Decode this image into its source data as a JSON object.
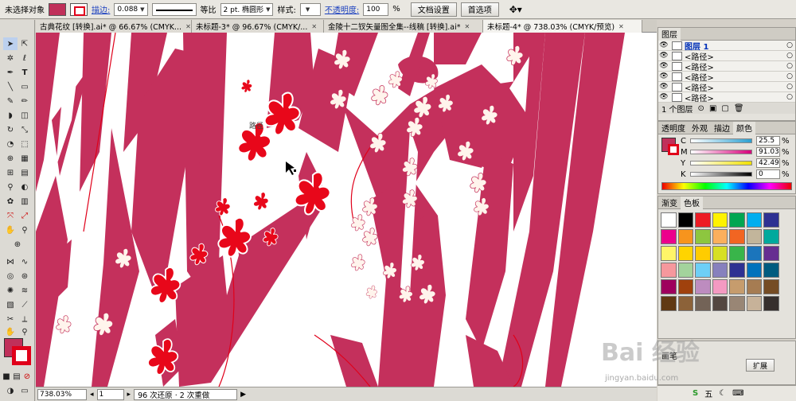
{
  "control_bar": {
    "selection": "未选择对象",
    "stroke_link": "描边:",
    "stroke_weight": "0.088",
    "profile": "等比",
    "brush": "2 pt. 椭圆形",
    "style_label": "样式:",
    "opacity_link": "不透明度:",
    "opacity_value": "100",
    "opacity_unit": "%",
    "doc_setup": "文档设置",
    "prefs": "首选项"
  },
  "tabs": [
    {
      "label": "古典花纹 [转换].ai* @ 66.67% (CMYK..."
    },
    {
      "label": "未标题-3* @ 96.67% (CMYK/..."
    },
    {
      "label": "金陵十二钗矢量图全集--线稿 [转换].ai*"
    },
    {
      "label": "未标题-4* @ 738.03% (CMYK/预览)"
    }
  ],
  "canvas": {
    "path_label": "路径"
  },
  "status": {
    "zoom": "738.03%",
    "page": "1",
    "history": "96 次还原 · 2 次重做"
  },
  "layers": {
    "tab": "图层",
    "rows": [
      {
        "name": "图层 1",
        "main": true
      },
      {
        "name": "<路径>",
        "main": false
      },
      {
        "name": "<路径>",
        "main": false
      },
      {
        "name": "<路径>",
        "main": false
      },
      {
        "name": "<路径>",
        "main": false
      },
      {
        "name": "<路径>",
        "main": false
      }
    ],
    "count": "1 个图层"
  },
  "color_panel": {
    "tabs": [
      "透明度",
      "外观",
      "描边",
      "颜色"
    ],
    "c": {
      "label": "C",
      "value": "25.5",
      "color": "#2a9fd0"
    },
    "m": {
      "label": "M",
      "value": "91.03",
      "color": "#d6007a"
    },
    "y": {
      "label": "Y",
      "value": "42.49",
      "color": "#f0e000"
    },
    "k": {
      "label": "K",
      "value": "0",
      "color": "#000000"
    },
    "unit": "%"
  },
  "swatches_panel": {
    "tabs": [
      "渐变",
      "色板"
    ],
    "colors": [
      "#ffffff",
      "#000000",
      "#ed1c24",
      "#fff200",
      "#00a651",
      "#00aeef",
      "#2e3192",
      "#ec008c",
      "#f7941d",
      "#8dc63f",
      "#fbaf5d",
      "#f26522",
      "#c2b59b",
      "#00a99d",
      "#fff568",
      "#ffd400",
      "#ffcc00",
      "#d7df23",
      "#39b54a",
      "#1b75bc",
      "#662d91",
      "#f6989d",
      "#a3d39c",
      "#6dcff6",
      "#8781bd",
      "#2e3192",
      "#0072bc",
      "#005b7f",
      "#9e005d",
      "#a0410d",
      "#bd8cbf",
      "#f49ac2",
      "#c69c6d",
      "#a67c52",
      "#754c24",
      "#603913",
      "#8c6239",
      "#736357",
      "#534741",
      "#998675",
      "#c7b299",
      "#362f2d"
    ],
    "label_a": "画笔",
    "label_b": "扩展"
  },
  "watermark": {
    "main": "Bai 经验",
    "sub": "jingyan.baidu.com"
  },
  "taskbar": {
    "ime": "五"
  }
}
